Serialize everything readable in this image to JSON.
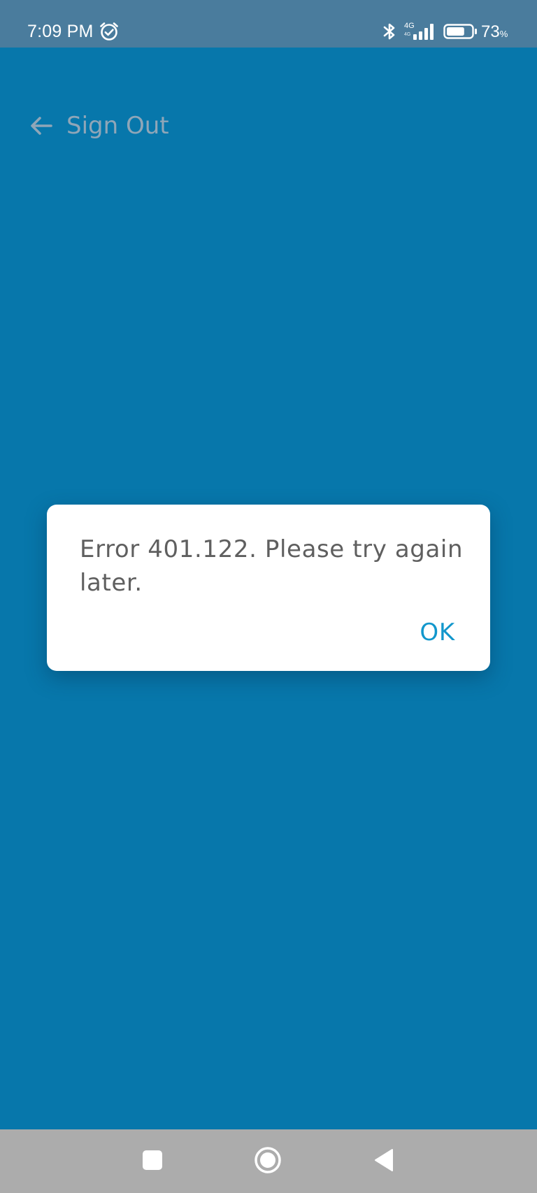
{
  "status_bar": {
    "time": "7:09 PM",
    "network_type": "4G",
    "network_sub": "4G",
    "battery_number": "73",
    "battery_unit": "%",
    "battery_level": 0.73,
    "icons": [
      "alarm-icon",
      "bluetooth-icon",
      "signal-icon",
      "battery-icon"
    ]
  },
  "header": {
    "back_icon": "back-arrow-icon",
    "title": "Sign Out"
  },
  "dialog": {
    "message": "Error 401.122. Please try again later.",
    "ok_label": "OK"
  },
  "nav_bar": {
    "icons": [
      "recent-apps-icon",
      "home-icon",
      "back-icon"
    ]
  },
  "colors": {
    "background": "#0777ab",
    "status_bar": "#4a7c9d",
    "header_text": "#8fa6b8",
    "dialog_text": "#5f5f5f",
    "accent": "#1297cc",
    "nav_bar": "#acacac"
  }
}
